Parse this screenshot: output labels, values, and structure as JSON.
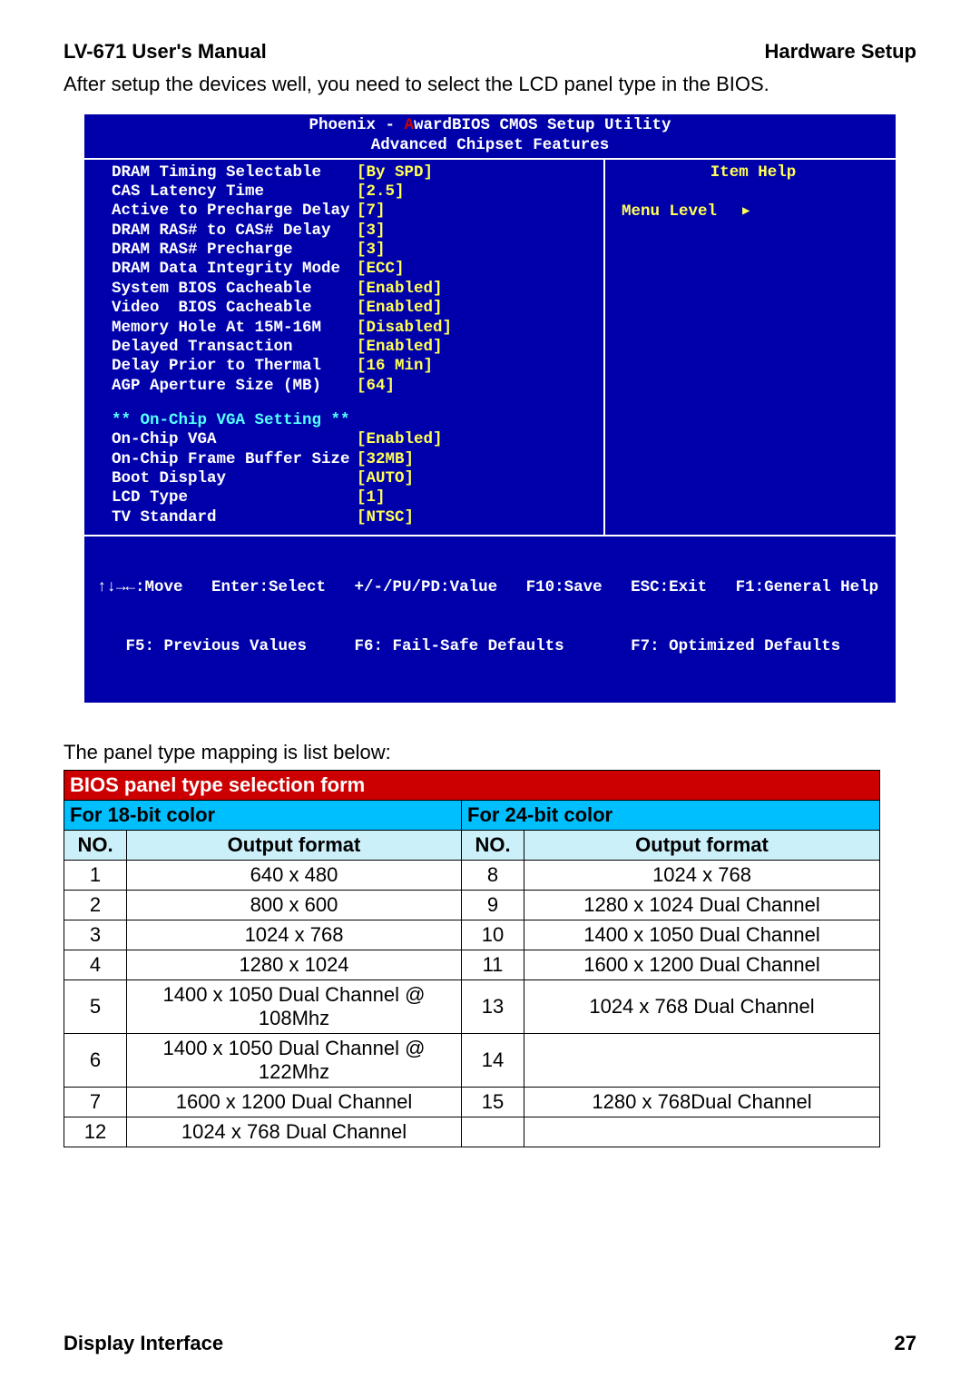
{
  "header": {
    "left": "LV-671 User's Manual",
    "right": "Hardware Setup"
  },
  "intro": "After setup the devices well, you need to select the LCD panel type in the BIOS.",
  "bios": {
    "title1_a": "Phoenix - ",
    "title1_b": "A",
    "title1_c": "wardBIOS CMOS Setup Utility",
    "title2": "Advanced Chipset Features",
    "settings": [
      {
        "label": "DRAM Timing Selectable",
        "value": "[By SPD]"
      },
      {
        "label": "CAS Latency Time",
        "value": "[2.5]"
      },
      {
        "label": "Active to Precharge Delay",
        "value": "[7]"
      },
      {
        "label": "DRAM RAS# to CAS# Delay",
        "value": "[3]"
      },
      {
        "label": "DRAM RAS# Precharge",
        "value": "[3]"
      },
      {
        "label": "DRAM Data Integrity Mode",
        "value": "[ECC]"
      },
      {
        "label": "System BIOS Cacheable",
        "value": "[Enabled]"
      },
      {
        "label": "Video  BIOS Cacheable",
        "value": "[Enabled]"
      },
      {
        "label": "Memory Hole At 15M-16M",
        "value": "[Disabled]"
      },
      {
        "label": "Delayed Transaction",
        "value": "[Enabled]"
      },
      {
        "label": "Delay Prior to Thermal",
        "value": "[16 Min]"
      },
      {
        "label": "AGP Aperture Size (MB)",
        "value": "[64]"
      }
    ],
    "section": "** On-Chip VGA Setting **",
    "settings2": [
      {
        "label": "On-Chip VGA",
        "value": "[Enabled]"
      },
      {
        "label": "On-Chip Frame Buffer Size",
        "value": "[32MB]"
      },
      {
        "label": "Boot Display",
        "value": "[AUTO]"
      },
      {
        "label": "LCD Type",
        "value": "[1]"
      },
      {
        "label": "TV Standard",
        "value": "[NTSC]"
      }
    ],
    "help_title": "Item Help",
    "menu_level": "Menu Level",
    "footer1": "↑↓→←:Move   Enter:Select   +/-/PU/PD:Value   F10:Save   ESC:Exit   F1:General Help",
    "footer2": "   F5: Previous Values     F6: Fail-Safe Defaults       F7: Optimized Defaults"
  },
  "caption": "The panel type mapping is list below:",
  "sel": {
    "title": "BIOS panel type selection form",
    "col18": "For 18-bit color",
    "col24": "For 24-bit color",
    "no": "NO.",
    "of": "Output format",
    "rows": [
      {
        "a": "1",
        "b": "640 x 480",
        "c": "8",
        "d": "1024 x 768"
      },
      {
        "a": "2",
        "b": "800 x 600",
        "c": "9",
        "d": "1280 x 1024 Dual Channel"
      },
      {
        "a": "3",
        "b": "1024 x 768",
        "c": "10",
        "d": "1400 x 1050 Dual Channel"
      },
      {
        "a": "4",
        "b": "1280 x 1024",
        "c": "11",
        "d": "1600 x 1200 Dual Channel"
      },
      {
        "a": "5",
        "b": "1400 x 1050 Dual Channel @ 108Mhz",
        "c": "13",
        "d": "1024 x 768 Dual Channel"
      },
      {
        "a": "6",
        "b": "1400 x 1050 Dual Channel @ 122Mhz",
        "c": "14",
        "d": ""
      },
      {
        "a": "7",
        "b": "1600 x 1200 Dual Channel",
        "c": "15",
        "d": "1280 x 768Dual Channel"
      },
      {
        "a": "12",
        "b": "1024 x 768 Dual Channel",
        "c": "",
        "d": ""
      }
    ]
  },
  "footer": {
    "left": "Display Interface",
    "right": "27"
  }
}
